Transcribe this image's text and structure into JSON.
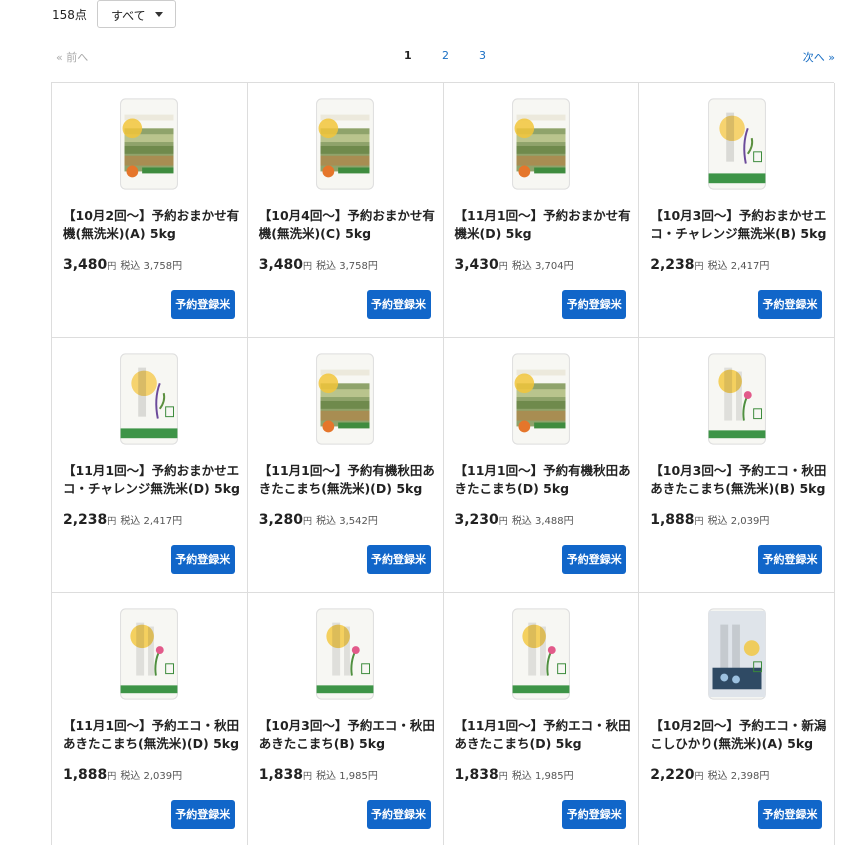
{
  "header": {
    "count": "158点",
    "filter_value": "すべて"
  },
  "pager": {
    "prev": "« 前へ",
    "pages": [
      "1",
      "2",
      "3"
    ],
    "next": "次へ »"
  },
  "colors": {
    "button": "#1166c9",
    "link": "#1a6fc4",
    "border": "#dddddd"
  },
  "products": [
    {
      "title": "【10月2回〜】予約おまかせ有機(無洗米)(A) 5kg",
      "price": "3,480",
      "unit": "円",
      "tax_label": "税込",
      "tax_price": "3,758円",
      "button": "予約登録米",
      "image": "organic-rice-bag"
    },
    {
      "title": "【10月4回〜】予約おまかせ有機(無洗米)(C) 5kg",
      "price": "3,480",
      "unit": "円",
      "tax_label": "税込",
      "tax_price": "3,758円",
      "button": "予約登録米",
      "image": "organic-rice-bag"
    },
    {
      "title": "【11月1回〜】予約おまかせ有機米(D) 5kg",
      "price": "3,430",
      "unit": "円",
      "tax_label": "税込",
      "tax_price": "3,704円",
      "button": "予約登録米",
      "image": "organic-rice-bag"
    },
    {
      "title": "【10月3回〜】予約おまかせエコ・チャレンジ無洗米(B) 5kg",
      "price": "2,238",
      "unit": "円",
      "tax_label": "税込",
      "tax_price": "2,417円",
      "button": "予約登録米",
      "image": "iwate-hitomebore-bag"
    },
    {
      "title": "【11月1回〜】予約おまかせエコ・チャレンジ無洗米(D) 5kg",
      "price": "2,238",
      "unit": "円",
      "tax_label": "税込",
      "tax_price": "2,417円",
      "button": "予約登録米",
      "image": "iwate-hitomebore-bag"
    },
    {
      "title": "【11月1回〜】予約有機秋田あきたこまち(無洗米)(D) 5kg",
      "price": "3,280",
      "unit": "円",
      "tax_label": "税込",
      "tax_price": "3,542円",
      "button": "予約登録米",
      "image": "organic-rice-bag"
    },
    {
      "title": "【11月1回〜】予約有機秋田あきたこまち(D) 5kg",
      "price": "3,230",
      "unit": "円",
      "tax_label": "税込",
      "tax_price": "3,488円",
      "button": "予約登録米",
      "image": "organic-rice-bag"
    },
    {
      "title": "【10月3回〜】予約エコ・秋田あきたこまち(無洗米)(B) 5kg",
      "price": "1,888",
      "unit": "円",
      "tax_label": "税込",
      "tax_price": "2,039円",
      "button": "予約登録米",
      "image": "akita-komachi-bag"
    },
    {
      "title": "【11月1回〜】予約エコ・秋田あきたこまち(無洗米)(D) 5kg",
      "price": "1,888",
      "unit": "円",
      "tax_label": "税込",
      "tax_price": "2,039円",
      "button": "予約登録米",
      "image": "akita-komachi-bag"
    },
    {
      "title": "【10月3回〜】予約エコ・秋田あきたこまち(B) 5kg",
      "price": "1,838",
      "unit": "円",
      "tax_label": "税込",
      "tax_price": "1,985円",
      "button": "予約登録米",
      "image": "akita-komachi-bag"
    },
    {
      "title": "【11月1回〜】予約エコ・秋田あきたこまち(D) 5kg",
      "price": "1,838",
      "unit": "円",
      "tax_label": "税込",
      "tax_price": "1,985円",
      "button": "予約登録米",
      "image": "akita-komachi-bag"
    },
    {
      "title": "【10月2回〜】予約エコ・新潟こしひかり(無洗米)(A) 5kg",
      "price": "2,220",
      "unit": "円",
      "tax_label": "税込",
      "tax_price": "2,398円",
      "button": "予約登録米",
      "image": "niigata-koshihikari-bag"
    }
  ]
}
